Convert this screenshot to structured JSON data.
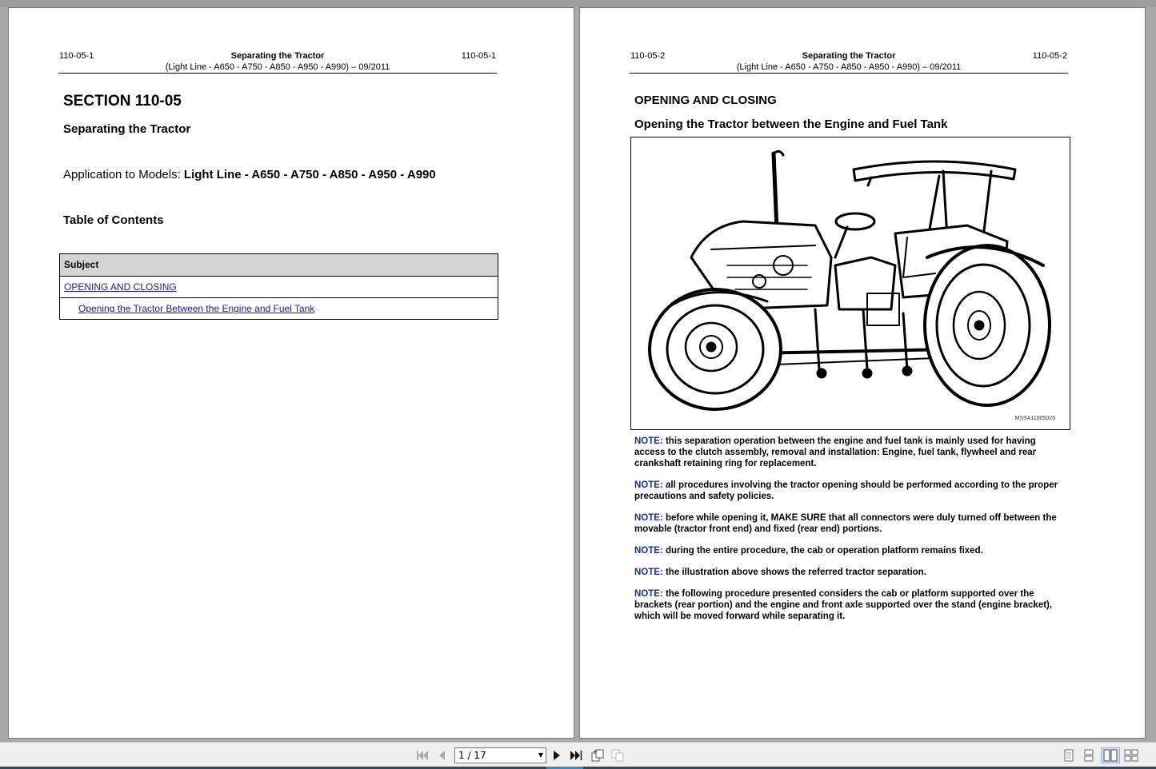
{
  "viewer": {
    "page_indicator": "1 / 17"
  },
  "left_page": {
    "header": {
      "page_num_left": "110-05-1",
      "page_num_right": "110-05-1",
      "title": "Separating the Tractor",
      "subtitle": "(Light Line - A650 - A750 - A850 - A950 - A990) – 09/2011"
    },
    "section_title": "SECTION 110-05",
    "section_subtitle": "Separating the Tractor",
    "models_prefix": "Application to Models: ",
    "models_value": "Light Line - A650 - A750 - A850 - A950 - A990",
    "toc_title": "Table of Contents",
    "toc": {
      "header": "Subject",
      "rows": [
        "OPENING AND CLOSING",
        "Opening the Tractor Between the Engine and Fuel Tank"
      ]
    }
  },
  "right_page": {
    "header": {
      "page_num_left": "110-05-2",
      "page_num_right": "110-05-2",
      "title": "Separating the Tractor",
      "subtitle": "(Light Line - A650 - A750 - A850 - A950 - A990) – 09/2011"
    },
    "heading1": "OPENING AND CLOSING",
    "heading2": "Opening the Tractor between the Engine and Fuel Tank",
    "figure_code": "MSSA11005025",
    "note_label": "NOTE:",
    "notes": [
      " this separation operation between the engine and fuel tank is mainly used for having access to the clutch assembly, removal and installation: Engine, fuel tank, flywheel and rear crankshaft retaining ring for replacement.",
      " all procedures involving the tractor opening should be performed according to the proper precautions and safety policies.",
      " before while opening it, MAKE SURE that all connectors were duly turned off between the movable (tractor front end) and fixed (rear end) portions.",
      " during the entire procedure, the cab or operation platform remains fixed.",
      " the illustration above shows the referred tractor separation.",
      " the following procedure presented considers the cab or platform supported over the brackets (rear portion) and the engine and front axle supported over the stand (engine bracket), which will be moved forward while separating it."
    ]
  }
}
